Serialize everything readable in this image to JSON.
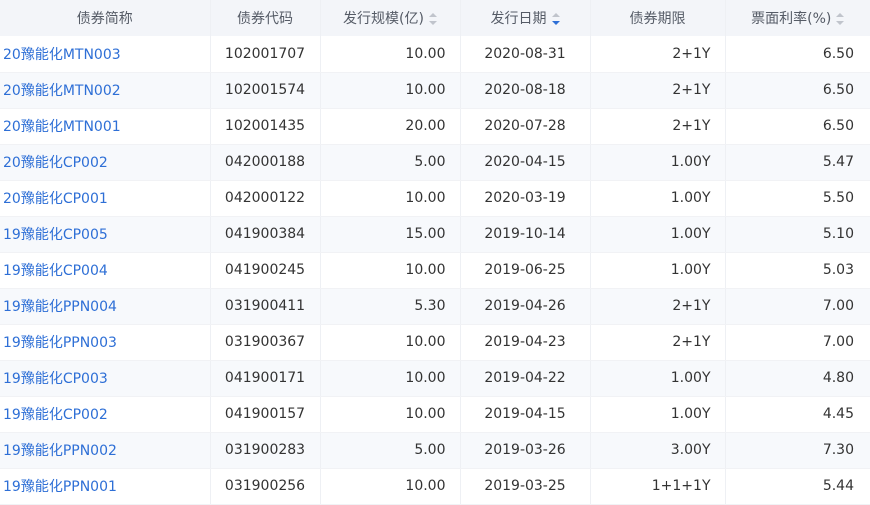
{
  "header": {
    "name": "债券简称",
    "code": "债券代码",
    "scale": "发行规模(亿)",
    "date": "发行日期",
    "term": "债券期限",
    "rate": "票面利率(%)"
  },
  "sort": {
    "active_column": "date",
    "direction": "desc"
  },
  "colors": {
    "link": "#2e6fd6",
    "header_bg": "#f3f5f9"
  },
  "rows": [
    {
      "name": "20豫能化MTN003",
      "code": "102001707",
      "scale": "10.00",
      "date": "2020-08-31",
      "term": "2+1Y",
      "rate": "6.50"
    },
    {
      "name": "20豫能化MTN002",
      "code": "102001574",
      "scale": "10.00",
      "date": "2020-08-18",
      "term": "2+1Y",
      "rate": "6.50"
    },
    {
      "name": "20豫能化MTN001",
      "code": "102001435",
      "scale": "20.00",
      "date": "2020-07-28",
      "term": "2+1Y",
      "rate": "6.50"
    },
    {
      "name": "20豫能化CP002",
      "code": "042000188",
      "scale": "5.00",
      "date": "2020-04-15",
      "term": "1.00Y",
      "rate": "5.47"
    },
    {
      "name": "20豫能化CP001",
      "code": "042000122",
      "scale": "10.00",
      "date": "2020-03-19",
      "term": "1.00Y",
      "rate": "5.50"
    },
    {
      "name": "19豫能化CP005",
      "code": "041900384",
      "scale": "15.00",
      "date": "2019-10-14",
      "term": "1.00Y",
      "rate": "5.10"
    },
    {
      "name": "19豫能化CP004",
      "code": "041900245",
      "scale": "10.00",
      "date": "2019-06-25",
      "term": "1.00Y",
      "rate": "5.03"
    },
    {
      "name": "19豫能化PPN004",
      "code": "031900411",
      "scale": "5.30",
      "date": "2019-04-26",
      "term": "2+1Y",
      "rate": "7.00"
    },
    {
      "name": "19豫能化PPN003",
      "code": "031900367",
      "scale": "10.00",
      "date": "2019-04-23",
      "term": "2+1Y",
      "rate": "7.00"
    },
    {
      "name": "19豫能化CP003",
      "code": "041900171",
      "scale": "10.00",
      "date": "2019-04-22",
      "term": "1.00Y",
      "rate": "4.80"
    },
    {
      "name": "19豫能化CP002",
      "code": "041900157",
      "scale": "10.00",
      "date": "2019-04-15",
      "term": "1.00Y",
      "rate": "4.45"
    },
    {
      "name": "19豫能化PPN002",
      "code": "031900283",
      "scale": "5.00",
      "date": "2019-03-26",
      "term": "3.00Y",
      "rate": "7.30"
    },
    {
      "name": "19豫能化PPN001",
      "code": "031900256",
      "scale": "10.00",
      "date": "2019-03-25",
      "term": "1+1+1Y",
      "rate": "5.44"
    }
  ]
}
